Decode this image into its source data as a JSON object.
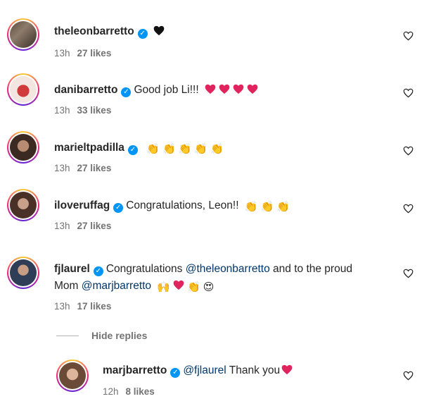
{
  "comments": [
    {
      "username": "theleonbarretto",
      "text": "",
      "emoji": "black-heart",
      "time": "13h",
      "likes": "27 likes"
    },
    {
      "username": "danibarretto",
      "text": "Good job Li!!!",
      "emoji": "4 red hearts",
      "time": "13h",
      "likes": "33 likes"
    },
    {
      "username": "marieltpadilla",
      "text": "",
      "emoji": "5 clapping hands",
      "time": "13h",
      "likes": "27 likes"
    },
    {
      "username": "iloveruffag",
      "text": "Congratulations, Leon!!",
      "emoji": "3 clapping hands",
      "time": "13h",
      "likes": "27 likes"
    },
    {
      "username": "fjlaurel",
      "text_before": "Congratulations",
      "mention1": "@theleonbarretto",
      "text_mid": "and to the proud",
      "line2_before": "Mom",
      "mention2": "@marjbarretto",
      "emoji": "raised hands, red heart, clapping hands, heart eyes",
      "time": "13h",
      "likes": "17 likes"
    }
  ],
  "hide_replies_label": "Hide replies",
  "reply": {
    "username": "marjbarretto",
    "mention": "@fjlaurel",
    "text": "Thank you",
    "emoji": "red-heart",
    "time": "12h",
    "likes": "8 likes"
  },
  "icons": [
    "verified-badge",
    "heart-outline-icon",
    "avatar"
  ],
  "colors": {
    "verified": "#0095f6",
    "mention": "#00376b",
    "meta": "#737373",
    "red_heart": "#e0245e"
  }
}
